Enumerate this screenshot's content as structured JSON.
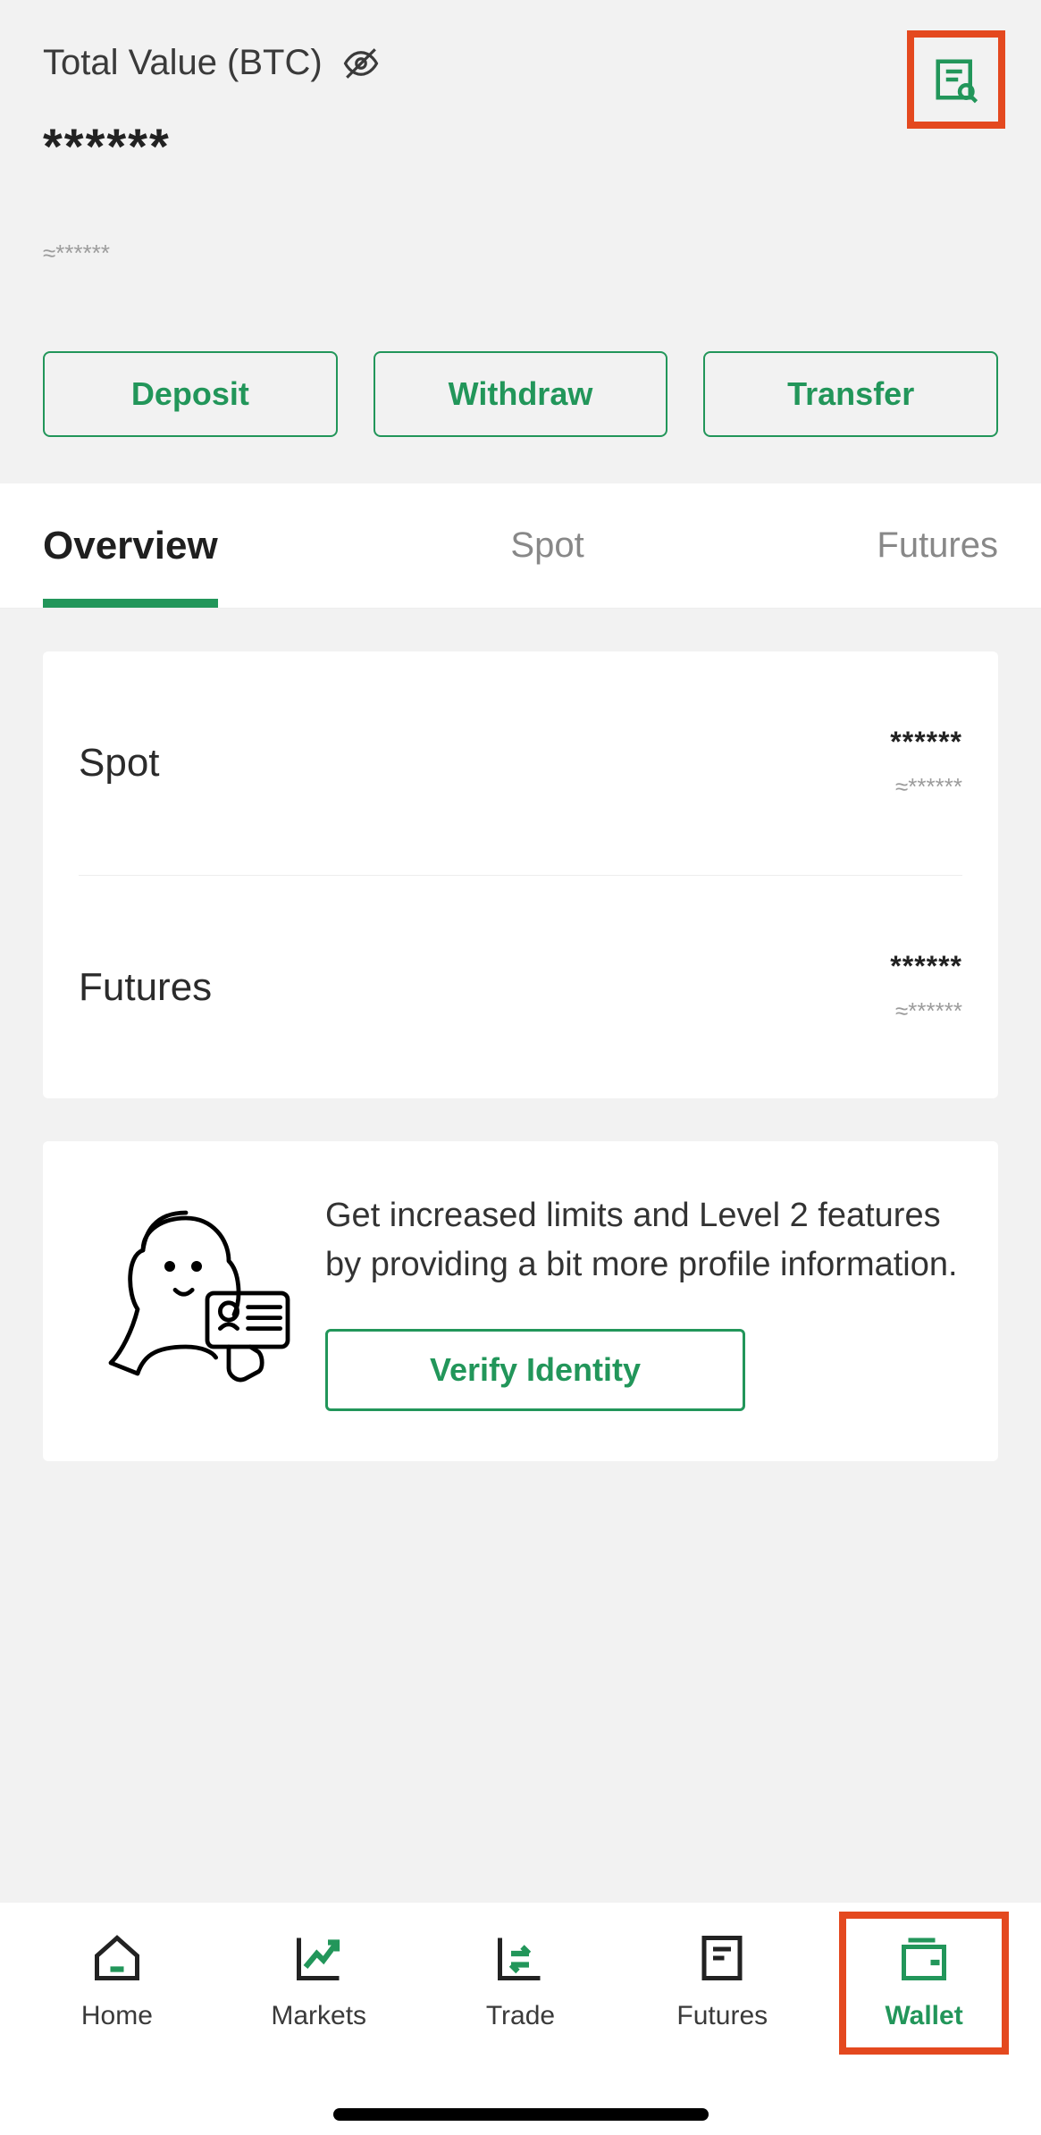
{
  "header": {
    "total_label": "Total Value (BTC)",
    "total_value": "******",
    "approx_value": "≈******"
  },
  "actions": {
    "deposit": "Deposit",
    "withdraw": "Withdraw",
    "transfer": "Transfer"
  },
  "tabs": {
    "overview": "Overview",
    "spot": "Spot",
    "futures": "Futures"
  },
  "balances": {
    "spot": {
      "label": "Spot",
      "main": "******",
      "sub": "≈******"
    },
    "futures": {
      "label": "Futures",
      "main": "******",
      "sub": "≈******"
    }
  },
  "verify": {
    "text": "Get increased limits and Level 2 features by providing a bit more profile information.",
    "button": "Verify Identity"
  },
  "nav": {
    "home": "Home",
    "markets": "Markets",
    "trade": "Trade",
    "futures": "Futures",
    "wallet": "Wallet"
  },
  "colors": {
    "accent": "#22965a",
    "highlight": "#e4491f"
  }
}
